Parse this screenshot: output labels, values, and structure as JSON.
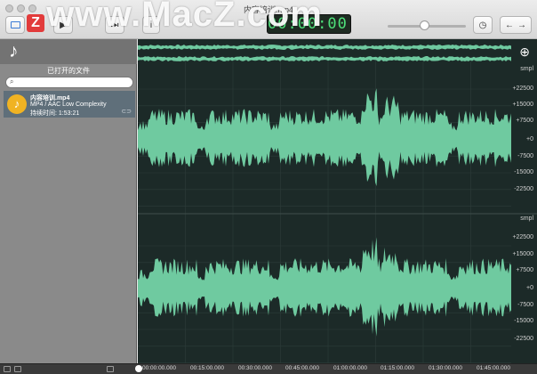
{
  "window": {
    "title": "内容培训.mp4"
  },
  "watermark": {
    "text": "www.MacZ.com",
    "logo_letter": "Z"
  },
  "toolbar": {
    "time_display": "00:00:00",
    "icons": [
      "sidebar-toggle-icon",
      "play-icon",
      "record-icon",
      "skip-icon",
      "info-icon",
      "volume-slider",
      "clock-icon",
      "undo-icon",
      "redo-icon"
    ],
    "info_label": "i",
    "undo_label": "←",
    "redo_label": "→"
  },
  "sidebar": {
    "title": "已打开的文件",
    "search": {
      "placeholder": ""
    },
    "files": [
      {
        "name": "内容培训.mp4",
        "format": "MP4 / AAC Low Complexity",
        "duration": "持续时间: 1:53:21"
      }
    ]
  },
  "waveform": {
    "unit": "smpl",
    "ticks": [
      "+22500",
      "+15000",
      "+7500",
      "+0",
      "-7500",
      "-15000",
      "-22500"
    ],
    "channels": 2,
    "accent_color": "#6fcaa0",
    "background": "#1c2a28"
  },
  "timeline": {
    "labels": [
      "00:00:00.000",
      "00:15:00.000",
      "00:30:00.000",
      "00:45:00.000",
      "01:00:00.000",
      "01:15:00.000",
      "01:30:00.000",
      "01:45:00.000"
    ]
  }
}
